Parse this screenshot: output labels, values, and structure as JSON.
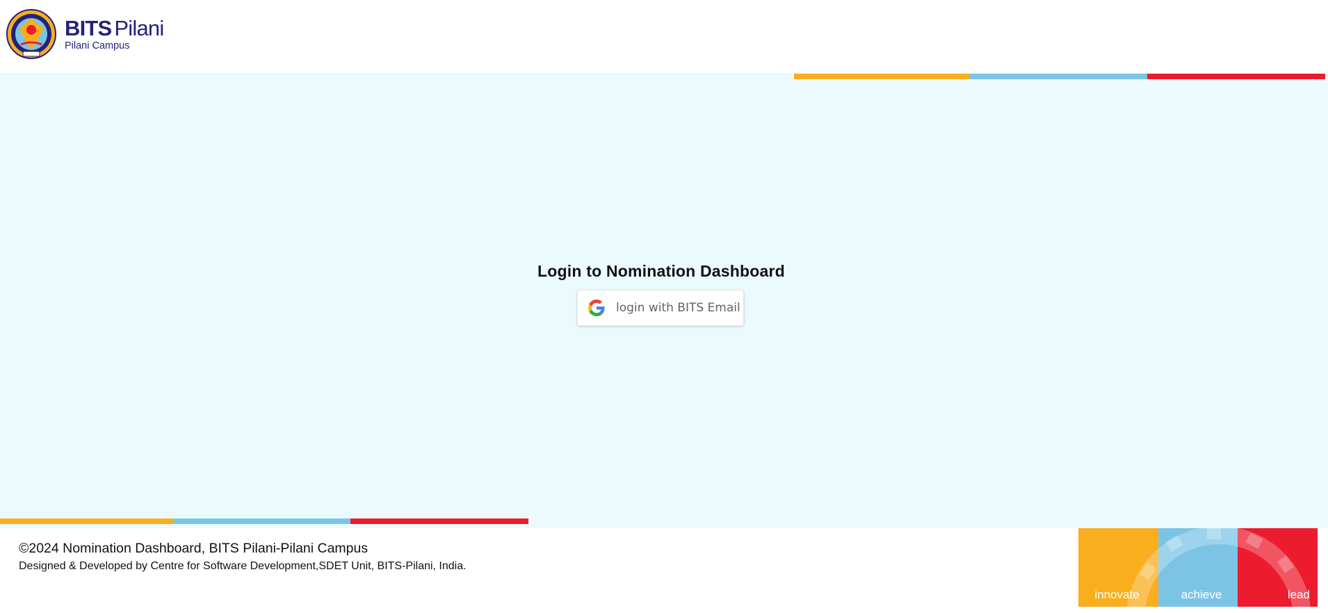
{
  "header": {
    "brand_primary": "BITS",
    "brand_secondary": "Pilani",
    "campus": "Pilani Campus",
    "seal_icon": "bits-pilani-seal-icon"
  },
  "colors": {
    "yellow": "#f9ae1e",
    "blue": "#7cc4e6",
    "red": "#ec1c2e",
    "brand_navy": "#24227a",
    "page_bg": "#ebfbfd"
  },
  "login": {
    "title": "Login to Nomination Dashboard",
    "button_label": "login with BITS Email",
    "button_icon": "google-g-icon"
  },
  "footer": {
    "copyright": "©2024 Nomination Dashboard, BITS Pilani-Pilani Campus",
    "credit": "Designed & Developed by Centre for Software Development,SDET Unit, BITS-Pilani, India.",
    "tagline": [
      "innovate",
      "achieve",
      "lead"
    ]
  }
}
